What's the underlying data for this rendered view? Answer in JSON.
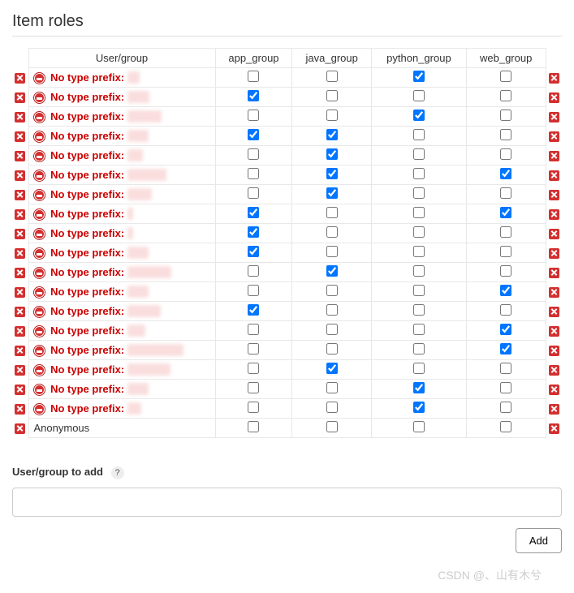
{
  "title": "Item roles",
  "columns": [
    "User/group",
    "app_group",
    "java_group",
    "python_group",
    "web_group"
  ],
  "error_prefix": "No type prefix:",
  "rows": [
    {
      "name_hidden": "ku",
      "err": true,
      "checks": [
        false,
        false,
        true,
        false
      ]
    },
    {
      "name_hidden": "uo o",
      "err": true,
      "checks": [
        true,
        false,
        false,
        false
      ]
    },
    {
      "name_hidden": "g qi ua",
      "err": true,
      "checks": [
        false,
        false,
        true,
        false
      ]
    },
    {
      "name_hidden": "h ao",
      "err": true,
      "checks": [
        true,
        true,
        false,
        false
      ]
    },
    {
      "name_hidden": "h il",
      "err": true,
      "checks": [
        false,
        true,
        false,
        false
      ]
    },
    {
      "name_hidden": "ji x iang",
      "err": true,
      "checks": [
        false,
        true,
        false,
        true
      ]
    },
    {
      "name_hidden": "li n g",
      "err": true,
      "checks": [
        false,
        true,
        false,
        false
      ]
    },
    {
      "name_hidden": "li   ",
      "err": true,
      "checks": [
        true,
        false,
        false,
        true
      ]
    },
    {
      "name_hidden": "li   ",
      "err": true,
      "checks": [
        true,
        false,
        false,
        false
      ]
    },
    {
      "name_hidden": "s sh",
      "err": true,
      "checks": [
        true,
        false,
        false,
        false
      ]
    },
    {
      "name_hidden": "w gh wei",
      "err": true,
      "checks": [
        false,
        true,
        false,
        false
      ]
    },
    {
      "name_hidden": "v gx",
      "err": true,
      "checks": [
        false,
        false,
        false,
        true
      ]
    },
    {
      "name_hidden": "v min i",
      "err": true,
      "checks": [
        true,
        false,
        false,
        false
      ]
    },
    {
      "name_hidden": "y qi",
      "err": true,
      "checks": [
        false,
        false,
        false,
        true
      ]
    },
    {
      "name_hidden": "y ygu hong",
      "err": true,
      "checks": [
        false,
        false,
        false,
        true
      ]
    },
    {
      "name_hidden": "z ng ong",
      "err": true,
      "checks": [
        false,
        true,
        false,
        false
      ]
    },
    {
      "name_hidden": "z    ng",
      "err": true,
      "checks": [
        false,
        false,
        true,
        false
      ]
    },
    {
      "name_hidden": "z e",
      "err": true,
      "checks": [
        false,
        false,
        true,
        false
      ]
    },
    {
      "name_plain": "Anonymous",
      "err": false,
      "checks": [
        false,
        false,
        false,
        false
      ]
    }
  ],
  "add_label": "User/group to add",
  "add_button": "Add",
  "watermark": "CSDN @、山有木兮"
}
